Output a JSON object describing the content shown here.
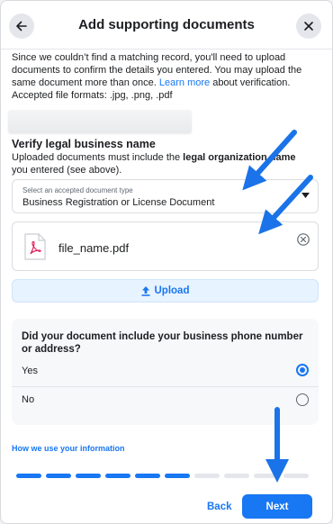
{
  "header": {
    "title": "Add supporting documents",
    "back_icon": "arrow-left-icon",
    "close_icon": "close-icon"
  },
  "intro": {
    "text_before_link": "Since we couldn’t find a matching record, you'll need to upload documents to confirm the details you entered. You may upload the same document more than once. ",
    "link": "Learn more",
    "text_after_link": " about verification. Accepted file formats: .jpg, .png, .pdf"
  },
  "verify": {
    "title": "Verify legal business name",
    "desc_before": "Uploaded documents must include the ",
    "desc_bold": "legal organization name",
    "desc_after": " you entered (see above)."
  },
  "document_select": {
    "label": "Select an accepted document type",
    "value": "Business Registration or License Document"
  },
  "file": {
    "name": "file_name.pdf",
    "icon": "pdf-file-icon",
    "remove_icon": "remove-circle-icon"
  },
  "upload": {
    "label": "Upload",
    "icon": "upload-icon"
  },
  "question": {
    "text": "Did your document include your business phone number or address?",
    "options": [
      {
        "label": "Yes",
        "selected": true
      },
      {
        "label": "No",
        "selected": false
      }
    ]
  },
  "footer": {
    "info_link": "How we use your information",
    "progress": {
      "completed_steps": 6,
      "total_steps": 10
    },
    "back_label": "Back",
    "next_label": "Next"
  },
  "colors": {
    "accent": "#1877f2",
    "upload_bg": "#e7f3ff",
    "annotation_arrow": "#1a73e8"
  }
}
